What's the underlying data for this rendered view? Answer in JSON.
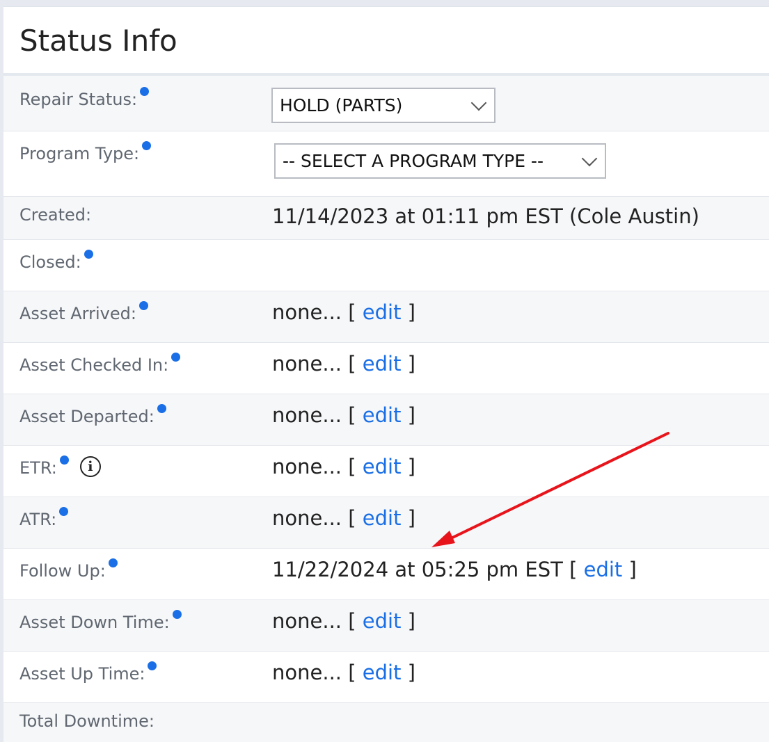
{
  "panel": {
    "title": "Status Info"
  },
  "rows": {
    "repair_status": {
      "label": "Repair Status:",
      "select_value": "HOLD (PARTS)"
    },
    "program_type": {
      "label": "Program Type:",
      "select_value": "-- SELECT A PROGRAM TYPE --"
    },
    "created": {
      "label": "Created:",
      "value": "11/14/2023 at 01:11 pm EST (Cole Austin)"
    },
    "closed": {
      "label": "Closed:"
    },
    "asset_arrived": {
      "label": "Asset Arrived:",
      "value": "none...",
      "edit": "edit"
    },
    "asset_checked_in": {
      "label": "Asset Checked In:",
      "value": "none...",
      "edit": "edit"
    },
    "asset_departed": {
      "label": "Asset Departed:",
      "value": "none...",
      "edit": "edit"
    },
    "etr": {
      "label": "ETR:",
      "value": "none...",
      "edit": "edit",
      "info_icon": "i"
    },
    "atr": {
      "label": "ATR:",
      "value": "none...",
      "edit": "edit"
    },
    "follow_up": {
      "label": "Follow Up:",
      "value": "11/22/2024 at 05:25 pm EST",
      "edit": "edit"
    },
    "asset_down_time": {
      "label": "Asset Down Time:",
      "value": "none...",
      "edit": "edit"
    },
    "asset_up_time": {
      "label": "Asset Up Time:",
      "value": "none...",
      "edit": "edit"
    },
    "total_downtime": {
      "label": "Total Downtime:"
    }
  },
  "brackets": {
    "open": "[",
    "close": "]"
  },
  "colors": {
    "accent_blue": "#1a6fe6",
    "annotation_arrow": "#e8141b",
    "row_alt": "#f6f7f9",
    "page_bg": "#e6e9f0"
  },
  "icons": {
    "required_dot": "required-dot-icon",
    "info": "info-icon",
    "dropdown": "chevron-down-icon",
    "annotation": "red-arrow-annotation"
  }
}
